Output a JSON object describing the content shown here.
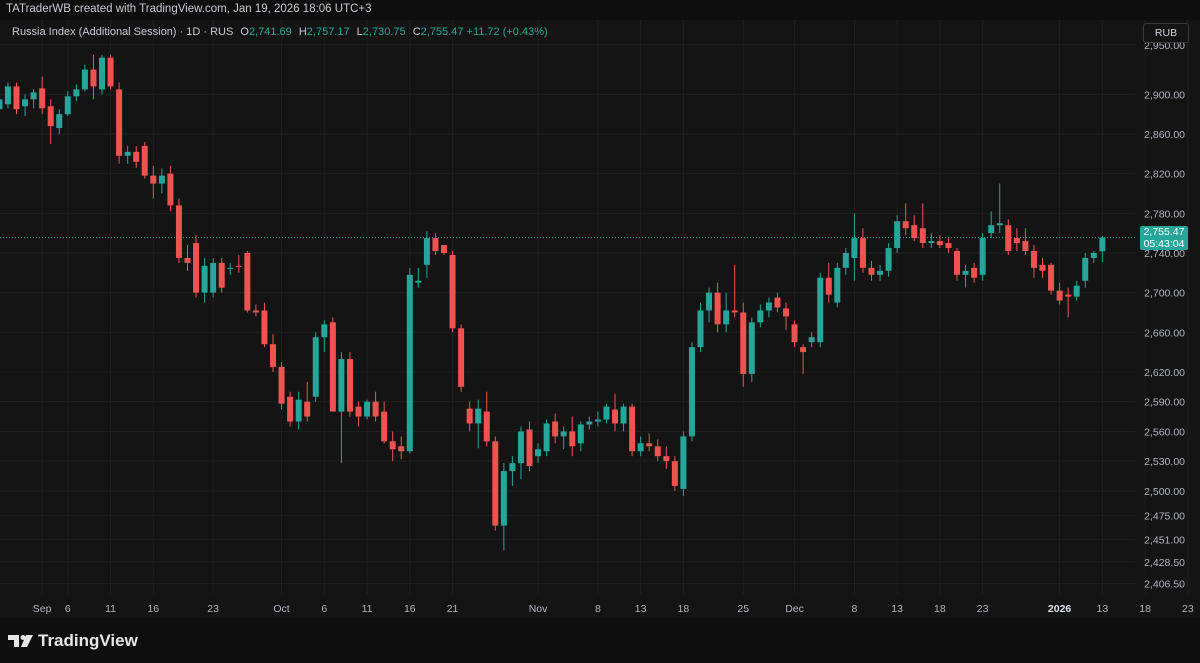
{
  "header": {
    "attribution": "TATraderWB created with TradingView.com, Jan 19, 2026 18:06 UTC+3"
  },
  "legend": {
    "symbol": "Russia Index (Additional Session) · 1D · RUS",
    "open_label": "O",
    "open_value": "2,741.69",
    "high_label": "H",
    "high_value": "2,757.17",
    "low_label": "L",
    "low_value": "2,730.75",
    "close_label": "C",
    "close_value": "2,755.47",
    "change": "+11.72 (+0.43%)"
  },
  "currency_badge": "RUB",
  "last_price_tag": {
    "price": "2,755.47",
    "countdown": "05:43:04"
  },
  "footer": {
    "brand": "TradingView"
  },
  "colors": {
    "up": "#26a69a",
    "down": "#ef5350",
    "background": "#141414"
  },
  "chart_data": {
    "type": "candlestick",
    "ylim": [
      2396,
      2975
    ],
    "last_price": 2755.47,
    "y_ticks": [
      {
        "label": "2,950.00",
        "value": 2950
      },
      {
        "label": "2,900.00",
        "value": 2900
      },
      {
        "label": "2,860.00",
        "value": 2860
      },
      {
        "label": "2,820.00",
        "value": 2820
      },
      {
        "label": "2,780.00",
        "value": 2780
      },
      {
        "label": "2,740.00",
        "value": 2740
      },
      {
        "label": "2,700.00",
        "value": 2700
      },
      {
        "label": "2,660.00",
        "value": 2660
      },
      {
        "label": "2,620.00",
        "value": 2620
      },
      {
        "label": "2,590.00",
        "value": 2590
      },
      {
        "label": "2,560.00",
        "value": 2560
      },
      {
        "label": "2,530.00",
        "value": 2530
      },
      {
        "label": "2,500.00",
        "value": 2500
      },
      {
        "label": "2,475.00",
        "value": 2475
      },
      {
        "label": "2,451.00",
        "value": 2451
      },
      {
        "label": "2,428.50",
        "value": 2428.5
      },
      {
        "label": "2,406.50",
        "value": 2406.5
      }
    ],
    "x_ticks": [
      {
        "label": "Sep",
        "day": 3,
        "bold": false
      },
      {
        "label": "6",
        "day": 6,
        "bold": false
      },
      {
        "label": "11",
        "day": 11,
        "bold": false
      },
      {
        "label": "16",
        "day": 16,
        "bold": false
      },
      {
        "label": "23",
        "day": 23,
        "bold": false
      },
      {
        "label": "Oct",
        "day": 31,
        "bold": false
      },
      {
        "label": "6",
        "day": 36,
        "bold": false
      },
      {
        "label": "11",
        "day": 41,
        "bold": false
      },
      {
        "label": "16",
        "day": 46,
        "bold": false
      },
      {
        "label": "21",
        "day": 51,
        "bold": false
      },
      {
        "label": "Nov",
        "day": 61,
        "bold": false
      },
      {
        "label": "8",
        "day": 68,
        "bold": false
      },
      {
        "label": "13",
        "day": 73,
        "bold": false
      },
      {
        "label": "18",
        "day": 78,
        "bold": false
      },
      {
        "label": "25",
        "day": 85,
        "bold": false
      },
      {
        "label": "Dec",
        "day": 91,
        "bold": false
      },
      {
        "label": "8",
        "day": 98,
        "bold": false
      },
      {
        "label": "13",
        "day": 103,
        "bold": false
      },
      {
        "label": "18",
        "day": 108,
        "bold": false
      },
      {
        "label": "23",
        "day": 113,
        "bold": false
      },
      {
        "label": "2026",
        "day": 122,
        "bold": true
      },
      {
        "label": "13",
        "day": 127,
        "bold": false
      },
      {
        "label": "18",
        "day": 132,
        "bold": false
      },
      {
        "label": "23",
        "day": 137,
        "bold": false
      }
    ],
    "ohlc": [
      {
        "t": -2,
        "o": 2885,
        "h": 2905,
        "l": 2880,
        "c": 2895
      },
      {
        "t": -1,
        "o": 2890,
        "h": 2912,
        "l": 2886,
        "c": 2908
      },
      {
        "t": 0,
        "o": 2908,
        "h": 2912,
        "l": 2880,
        "c": 2885
      },
      {
        "t": 1,
        "o": 2888,
        "h": 2900,
        "l": 2878,
        "c": 2895
      },
      {
        "t": 2,
        "o": 2895,
        "h": 2905,
        "l": 2886,
        "c": 2902
      },
      {
        "t": 3,
        "o": 2906,
        "h": 2918,
        "l": 2880,
        "c": 2886
      },
      {
        "t": 4,
        "o": 2888,
        "h": 2895,
        "l": 2850,
        "c": 2868
      },
      {
        "t": 5,
        "o": 2866,
        "h": 2885,
        "l": 2860,
        "c": 2880
      },
      {
        "t": 6,
        "o": 2880,
        "h": 2903,
        "l": 2878,
        "c": 2898
      },
      {
        "t": 7,
        "o": 2898,
        "h": 2910,
        "l": 2893,
        "c": 2905
      },
      {
        "t": 8,
        "o": 2905,
        "h": 2930,
        "l": 2903,
        "c": 2925
      },
      {
        "t": 9,
        "o": 2925,
        "h": 2940,
        "l": 2895,
        "c": 2908
      },
      {
        "t": 10,
        "o": 2905,
        "h": 2940,
        "l": 2900,
        "c": 2937
      },
      {
        "t": 11,
        "o": 2937,
        "h": 2940,
        "l": 2905,
        "c": 2908
      },
      {
        "t": 12,
        "o": 2905,
        "h": 2912,
        "l": 2830,
        "c": 2838
      },
      {
        "t": 13,
        "o": 2838,
        "h": 2848,
        "l": 2830,
        "c": 2842
      },
      {
        "t": 14,
        "o": 2842,
        "h": 2848,
        "l": 2826,
        "c": 2832
      },
      {
        "t": 15,
        "o": 2848,
        "h": 2852,
        "l": 2815,
        "c": 2818
      },
      {
        "t": 16,
        "o": 2818,
        "h": 2828,
        "l": 2795,
        "c": 2810
      },
      {
        "t": 17,
        "o": 2810,
        "h": 2825,
        "l": 2800,
        "c": 2818
      },
      {
        "t": 18,
        "o": 2820,
        "h": 2828,
        "l": 2782,
        "c": 2788
      },
      {
        "t": 19,
        "o": 2788,
        "h": 2795,
        "l": 2730,
        "c": 2735
      },
      {
        "t": 20,
        "o": 2735,
        "h": 2748,
        "l": 2722,
        "c": 2730
      },
      {
        "t": 21,
        "o": 2750,
        "h": 2758,
        "l": 2695,
        "c": 2700
      },
      {
        "t": 22,
        "o": 2700,
        "h": 2735,
        "l": 2690,
        "c": 2727
      },
      {
        "t": 23,
        "o": 2700,
        "h": 2735,
        "l": 2695,
        "c": 2730
      },
      {
        "t": 24,
        "o": 2730,
        "h": 2735,
        "l": 2700,
        "c": 2705
      },
      {
        "t": 25,
        "o": 2725,
        "h": 2730,
        "l": 2718,
        "c": 2725
      },
      {
        "t": 26,
        "o": 2727,
        "h": 2738,
        "l": 2720,
        "c": 2726
      },
      {
        "t": 27,
        "o": 2740,
        "h": 2742,
        "l": 2680,
        "c": 2682
      },
      {
        "t": 28,
        "o": 2682,
        "h": 2688,
        "l": 2676,
        "c": 2680
      },
      {
        "t": 29,
        "o": 2682,
        "h": 2690,
        "l": 2645,
        "c": 2648
      },
      {
        "t": 30,
        "o": 2648,
        "h": 2658,
        "l": 2620,
        "c": 2625
      },
      {
        "t": 31,
        "o": 2625,
        "h": 2630,
        "l": 2582,
        "c": 2588
      },
      {
        "t": 32,
        "o": 2595,
        "h": 2600,
        "l": 2565,
        "c": 2570
      },
      {
        "t": 33,
        "o": 2570,
        "h": 2600,
        "l": 2562,
        "c": 2592
      },
      {
        "t": 34,
        "o": 2590,
        "h": 2610,
        "l": 2570,
        "c": 2575
      },
      {
        "t": 35,
        "o": 2595,
        "h": 2660,
        "l": 2590,
        "c": 2655
      },
      {
        "t": 36,
        "o": 2655,
        "h": 2672,
        "l": 2640,
        "c": 2668
      },
      {
        "t": 37,
        "o": 2670,
        "h": 2675,
        "l": 2580,
        "c": 2580
      },
      {
        "t": 38,
        "o": 2580,
        "h": 2640,
        "l": 2528,
        "c": 2633
      },
      {
        "t": 39,
        "o": 2633,
        "h": 2640,
        "l": 2575,
        "c": 2580
      },
      {
        "t": 40,
        "o": 2585,
        "h": 2590,
        "l": 2565,
        "c": 2575
      },
      {
        "t": 41,
        "o": 2575,
        "h": 2592,
        "l": 2572,
        "c": 2590
      },
      {
        "t": 42,
        "o": 2590,
        "h": 2600,
        "l": 2570,
        "c": 2575
      },
      {
        "t": 43,
        "o": 2580,
        "h": 2590,
        "l": 2548,
        "c": 2550
      },
      {
        "t": 44,
        "o": 2550,
        "h": 2560,
        "l": 2530,
        "c": 2542
      },
      {
        "t": 45,
        "o": 2545,
        "h": 2555,
        "l": 2532,
        "c": 2540
      },
      {
        "t": 46,
        "o": 2540,
        "h": 2725,
        "l": 2538,
        "c": 2718
      },
      {
        "t": 47,
        "o": 2710,
        "h": 2725,
        "l": 2705,
        "c": 2712
      },
      {
        "t": 48,
        "o": 2728,
        "h": 2762,
        "l": 2715,
        "c": 2755
      },
      {
        "t": 49,
        "o": 2755,
        "h": 2760,
        "l": 2738,
        "c": 2742
      },
      {
        "t": 50,
        "o": 2748,
        "h": 2745,
        "l": 2738,
        "c": 2740
      },
      {
        "t": 51,
        "o": 2738,
        "h": 2742,
        "l": 2660,
        "c": 2664
      },
      {
        "t": 52,
        "o": 2664,
        "h": 2668,
        "l": 2600,
        "c": 2605
      },
      {
        "t": 53,
        "o": 2583,
        "h": 2590,
        "l": 2560,
        "c": 2568
      },
      {
        "t": 54,
        "o": 2568,
        "h": 2592,
        "l": 2543,
        "c": 2583
      },
      {
        "t": 55,
        "o": 2580,
        "h": 2600,
        "l": 2545,
        "c": 2550
      },
      {
        "t": 56,
        "o": 2550,
        "h": 2555,
        "l": 2460,
        "c": 2465
      },
      {
        "t": 57,
        "o": 2465,
        "h": 2528,
        "l": 2440,
        "c": 2520
      },
      {
        "t": 58,
        "o": 2520,
        "h": 2535,
        "l": 2505,
        "c": 2528
      },
      {
        "t": 59,
        "o": 2528,
        "h": 2565,
        "l": 2512,
        "c": 2560
      },
      {
        "t": 60,
        "o": 2562,
        "h": 2570,
        "l": 2520,
        "c": 2525
      },
      {
        "t": 61,
        "o": 2535,
        "h": 2548,
        "l": 2528,
        "c": 2542
      },
      {
        "t": 62,
        "o": 2540,
        "h": 2572,
        "l": 2535,
        "c": 2568
      },
      {
        "t": 63,
        "o": 2570,
        "h": 2578,
        "l": 2548,
        "c": 2555
      },
      {
        "t": 64,
        "o": 2555,
        "h": 2565,
        "l": 2542,
        "c": 2560
      },
      {
        "t": 65,
        "o": 2560,
        "h": 2575,
        "l": 2535,
        "c": 2545
      },
      {
        "t": 66,
        "o": 2548,
        "h": 2570,
        "l": 2540,
        "c": 2567
      },
      {
        "t": 67,
        "o": 2567,
        "h": 2575,
        "l": 2562,
        "c": 2570
      },
      {
        "t": 68,
        "o": 2570,
        "h": 2580,
        "l": 2565,
        "c": 2572
      },
      {
        "t": 69,
        "o": 2572,
        "h": 2588,
        "l": 2568,
        "c": 2585
      },
      {
        "t": 70,
        "o": 2582,
        "h": 2598,
        "l": 2560,
        "c": 2568
      },
      {
        "t": 71,
        "o": 2568,
        "h": 2588,
        "l": 2560,
        "c": 2585
      },
      {
        "t": 72,
        "o": 2585,
        "h": 2588,
        "l": 2535,
        "c": 2540
      },
      {
        "t": 73,
        "o": 2540,
        "h": 2555,
        "l": 2535,
        "c": 2548
      },
      {
        "t": 74,
        "o": 2548,
        "h": 2558,
        "l": 2540,
        "c": 2545
      },
      {
        "t": 75,
        "o": 2545,
        "h": 2552,
        "l": 2530,
        "c": 2535
      },
      {
        "t": 76,
        "o": 2535,
        "h": 2545,
        "l": 2522,
        "c": 2530
      },
      {
        "t": 77,
        "o": 2530,
        "h": 2535,
        "l": 2500,
        "c": 2505
      },
      {
        "t": 78,
        "o": 2502,
        "h": 2560,
        "l": 2495,
        "c": 2555
      },
      {
        "t": 79,
        "o": 2555,
        "h": 2650,
        "l": 2550,
        "c": 2645
      },
      {
        "t": 80,
        "o": 2645,
        "h": 2690,
        "l": 2640,
        "c": 2682
      },
      {
        "t": 81,
        "o": 2682,
        "h": 2705,
        "l": 2670,
        "c": 2700
      },
      {
        "t": 82,
        "o": 2700,
        "h": 2710,
        "l": 2660,
        "c": 2668
      },
      {
        "t": 83,
        "o": 2668,
        "h": 2700,
        "l": 2660,
        "c": 2682
      },
      {
        "t": 84,
        "o": 2682,
        "h": 2728,
        "l": 2675,
        "c": 2680
      },
      {
        "t": 85,
        "o": 2680,
        "h": 2690,
        "l": 2605,
        "c": 2618
      },
      {
        "t": 86,
        "o": 2618,
        "h": 2675,
        "l": 2610,
        "c": 2670
      },
      {
        "t": 87,
        "o": 2670,
        "h": 2688,
        "l": 2665,
        "c": 2682
      },
      {
        "t": 88,
        "o": 2682,
        "h": 2695,
        "l": 2675,
        "c": 2690
      },
      {
        "t": 89,
        "o": 2695,
        "h": 2700,
        "l": 2680,
        "c": 2685
      },
      {
        "t": 90,
        "o": 2684,
        "h": 2690,
        "l": 2662,
        "c": 2676
      },
      {
        "t": 91,
        "o": 2668,
        "h": 2672,
        "l": 2645,
        "c": 2650
      },
      {
        "t": 92,
        "o": 2645,
        "h": 2648,
        "l": 2618,
        "c": 2640
      },
      {
        "t": 93,
        "o": 2650,
        "h": 2660,
        "l": 2645,
        "c": 2655
      },
      {
        "t": 94,
        "o": 2650,
        "h": 2720,
        "l": 2645,
        "c": 2715
      },
      {
        "t": 95,
        "o": 2715,
        "h": 2730,
        "l": 2690,
        "c": 2698
      },
      {
        "t": 96,
        "o": 2690,
        "h": 2730,
        "l": 2685,
        "c": 2725
      },
      {
        "t": 97,
        "o": 2725,
        "h": 2745,
        "l": 2718,
        "c": 2740
      },
      {
        "t": 98,
        "o": 2735,
        "h": 2780,
        "l": 2712,
        "c": 2755
      },
      {
        "t": 99,
        "o": 2755,
        "h": 2765,
        "l": 2720,
        "c": 2725
      },
      {
        "t": 100,
        "o": 2725,
        "h": 2732,
        "l": 2712,
        "c": 2718
      },
      {
        "t": 101,
        "o": 2718,
        "h": 2728,
        "l": 2712,
        "c": 2722
      },
      {
        "t": 102,
        "o": 2722,
        "h": 2750,
        "l": 2716,
        "c": 2745
      },
      {
        "t": 103,
        "o": 2745,
        "h": 2778,
        "l": 2740,
        "c": 2772
      },
      {
        "t": 104,
        "o": 2772,
        "h": 2790,
        "l": 2758,
        "c": 2765
      },
      {
        "t": 105,
        "o": 2768,
        "h": 2778,
        "l": 2752,
        "c": 2755
      },
      {
        "t": 106,
        "o": 2765,
        "h": 2790,
        "l": 2745,
        "c": 2750
      },
      {
        "t": 107,
        "o": 2750,
        "h": 2760,
        "l": 2745,
        "c": 2752
      },
      {
        "t": 108,
        "o": 2752,
        "h": 2758,
        "l": 2745,
        "c": 2748
      },
      {
        "t": 109,
        "o": 2750,
        "h": 2755,
        "l": 2740,
        "c": 2745
      },
      {
        "t": 110,
        "o": 2742,
        "h": 2745,
        "l": 2712,
        "c": 2718
      },
      {
        "t": 111,
        "o": 2718,
        "h": 2728,
        "l": 2705,
        "c": 2722
      },
      {
        "t": 112,
        "o": 2725,
        "h": 2730,
        "l": 2710,
        "c": 2715
      },
      {
        "t": 113,
        "o": 2718,
        "h": 2760,
        "l": 2712,
        "c": 2755
      },
      {
        "t": 114,
        "o": 2760,
        "h": 2782,
        "l": 2755,
        "c": 2768
      },
      {
        "t": 115,
        "o": 2768,
        "h": 2810,
        "l": 2760,
        "c": 2770
      },
      {
        "t": 116,
        "o": 2768,
        "h": 2774,
        "l": 2738,
        "c": 2742
      },
      {
        "t": 117,
        "o": 2755,
        "h": 2765,
        "l": 2742,
        "c": 2750
      },
      {
        "t": 118,
        "o": 2752,
        "h": 2765,
        "l": 2738,
        "c": 2742
      },
      {
        "t": 119,
        "o": 2742,
        "h": 2748,
        "l": 2715,
        "c": 2725
      },
      {
        "t": 120,
        "o": 2728,
        "h": 2735,
        "l": 2715,
        "c": 2722
      },
      {
        "t": 121,
        "o": 2728,
        "h": 2730,
        "l": 2698,
        "c": 2702
      },
      {
        "t": 122,
        "o": 2702,
        "h": 2710,
        "l": 2688,
        "c": 2692
      },
      {
        "t": 123,
        "o": 2698,
        "h": 2705,
        "l": 2675,
        "c": 2696
      },
      {
        "t": 124,
        "o": 2696,
        "h": 2712,
        "l": 2692,
        "c": 2707
      },
      {
        "t": 125,
        "o": 2712,
        "h": 2740,
        "l": 2705,
        "c": 2735
      },
      {
        "t": 126,
        "o": 2735,
        "h": 2742,
        "l": 2730,
        "c": 2740
      },
      {
        "t": 127,
        "o": 2741.69,
        "h": 2757.17,
        "l": 2730.75,
        "c": 2755.47
      }
    ]
  }
}
